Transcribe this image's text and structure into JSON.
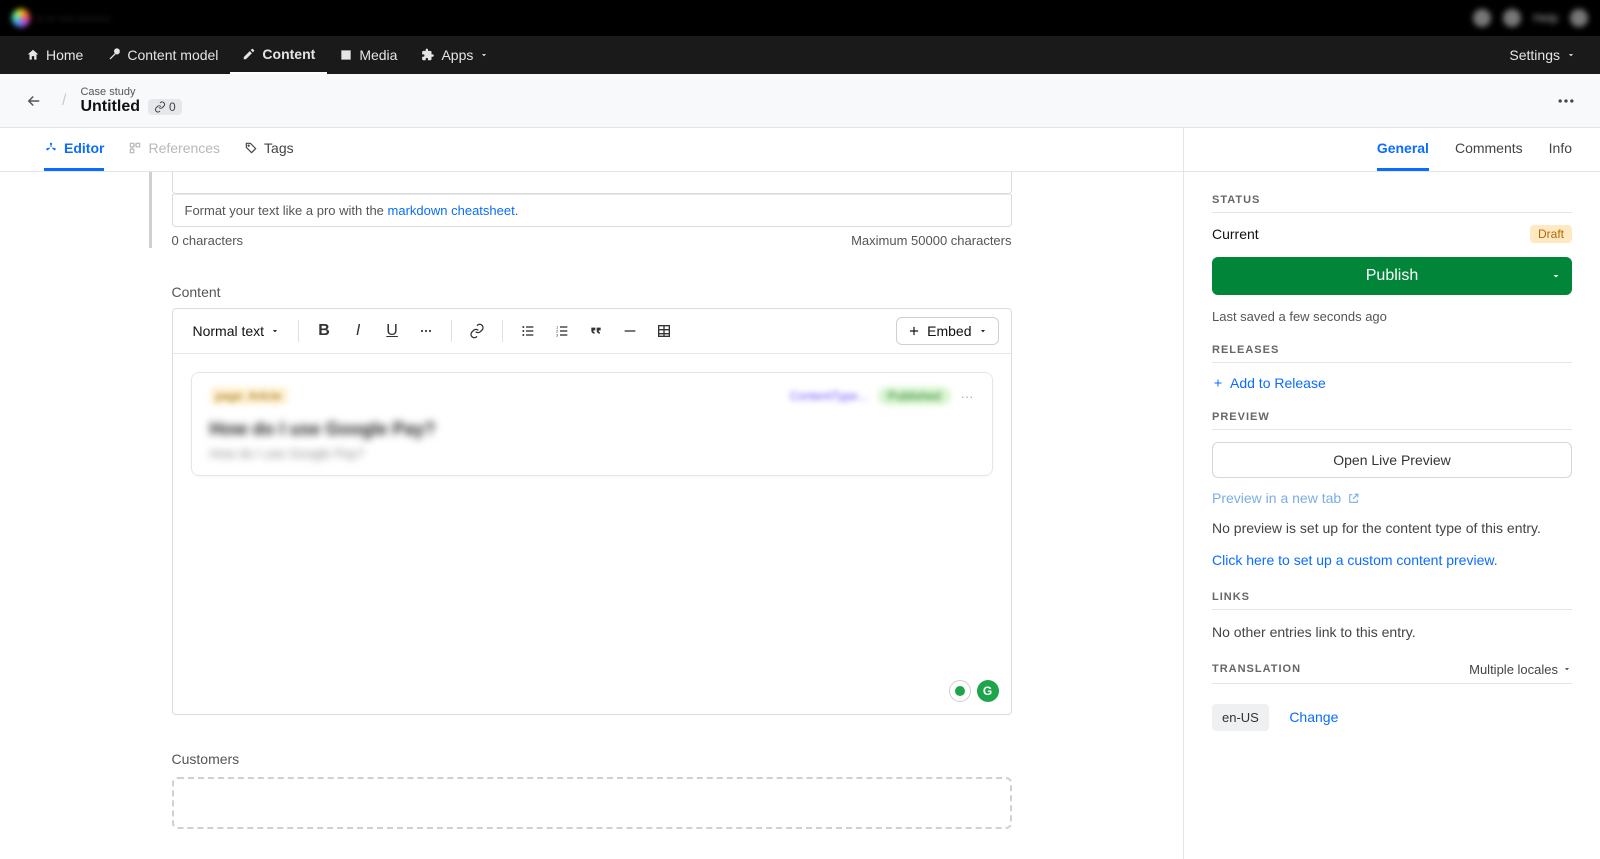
{
  "titlebar": {
    "help": "Help"
  },
  "topnav": {
    "home": "Home",
    "content_model": "Content model",
    "content": "Content",
    "media": "Media",
    "apps": "Apps",
    "settings": "Settings"
  },
  "subheader": {
    "content_type": "Case study",
    "title": "Untitled",
    "link_count": "0"
  },
  "tabs": {
    "editor": "Editor",
    "references": "References",
    "tags": "Tags"
  },
  "prev_field": {
    "hint_prefix": "Format your text like a pro with the ",
    "hint_link": "markdown cheatsheet",
    "hint_suffix": ".",
    "char_count": "0 characters",
    "max": "Maximum 50000 characters"
  },
  "content_field": {
    "label": "Content",
    "style": "Normal text",
    "embed": "Embed",
    "card": {
      "type_badge": "page: Article",
      "middle": "ContentType...",
      "status": "Published",
      "title": "How do I use Google Pay?",
      "sub": "How do I use Google Pay?"
    }
  },
  "customers_field": {
    "label": "Customers"
  },
  "side_tabs": {
    "general": "General",
    "comments": "Comments",
    "info": "Info"
  },
  "status": {
    "heading": "STATUS",
    "current_label": "Current",
    "draft": "Draft",
    "publish": "Publish",
    "last_saved": "Last saved a few seconds ago"
  },
  "releases": {
    "heading": "RELEASES",
    "add": "Add to Release"
  },
  "preview": {
    "heading": "PREVIEW",
    "open": "Open Live Preview",
    "new_tab": "Preview in a new tab",
    "no_preview": "No preview is set up for the content type of this entry.",
    "setup_link": "Click here to set up a custom content preview."
  },
  "links": {
    "heading": "LINKS",
    "text": "No other entries link to this entry."
  },
  "translation": {
    "heading": "TRANSLATION",
    "multiple": "Multiple locales",
    "locale": "en-US",
    "change": "Change"
  }
}
